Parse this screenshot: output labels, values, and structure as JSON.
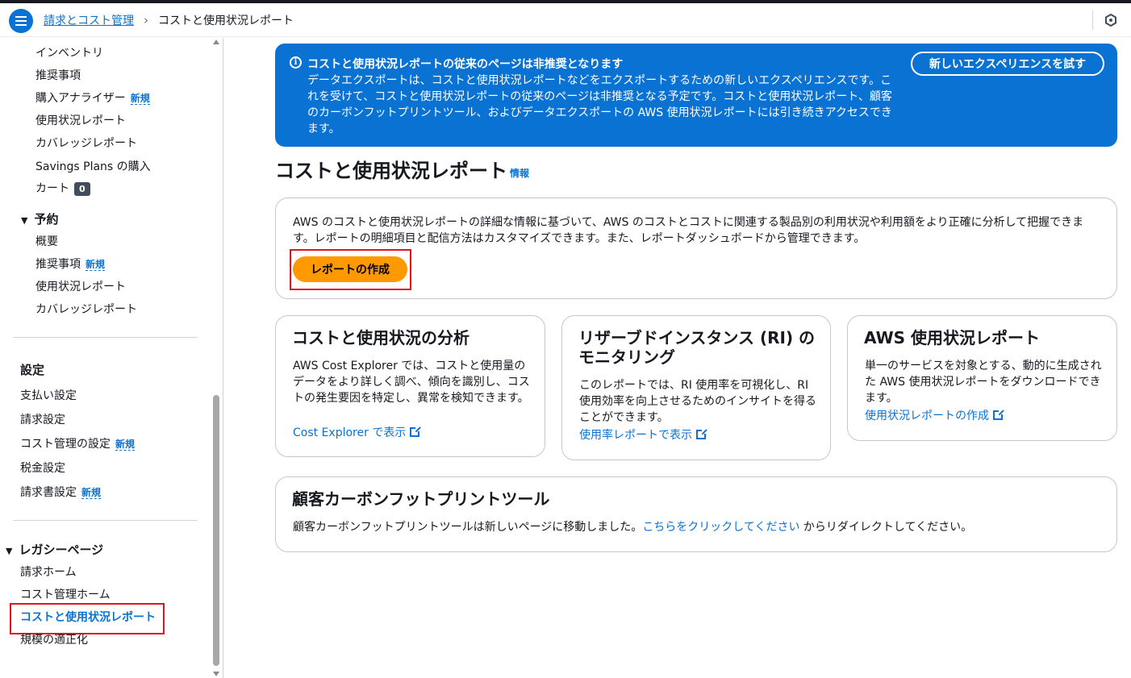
{
  "header": {
    "breadcrumb_parent": "請求とコスト管理",
    "breadcrumb_sep": "›",
    "breadcrumb_current": "コストと使用状況レポート"
  },
  "sidebar": {
    "items_top": [
      {
        "label": "インベントリ"
      },
      {
        "label": "推奨事項"
      },
      {
        "label": "購入アナライザー",
        "badge": "新規"
      },
      {
        "label": "使用状況レポート"
      },
      {
        "label": "カバレッジレポート"
      },
      {
        "label": "Savings Plans の購入"
      },
      {
        "label": "カート",
        "count": "0"
      }
    ],
    "reservations": {
      "title": "予約",
      "items": [
        {
          "label": "概要"
        },
        {
          "label": "推奨事項",
          "badge": "新規"
        },
        {
          "label": "使用状況レポート"
        },
        {
          "label": "カバレッジレポート"
        }
      ]
    },
    "settings": {
      "title": "設定",
      "items": [
        {
          "label": "支払い設定"
        },
        {
          "label": "請求設定"
        },
        {
          "label": "コスト管理の設定",
          "badge": "新規"
        },
        {
          "label": "税金設定"
        },
        {
          "label": "請求書設定",
          "badge": "新規"
        }
      ]
    },
    "legacy": {
      "title": "レガシーページ",
      "items": [
        {
          "label": "請求ホーム"
        },
        {
          "label": "コスト管理ホーム"
        },
        {
          "label": "コストと使用状況レポート",
          "active": true
        },
        {
          "label": "規模の適正化"
        }
      ]
    }
  },
  "banner": {
    "title": "コストと使用状況レポートの従来のページは非推奨となります",
    "body": "データエクスポートは、コストと使用状況レポートなどをエクスポートするための新しいエクスペリエンスです。これを受けて、コストと使用状況レポートの従来のページは非推奨となる予定です。コストと使用状況レポート、顧客のカーボンフットプリントツール、およびデータエクスポートの AWS 使用状況レポートには引き続きアクセスできます。",
    "button": "新しいエクスペリエンスを試す"
  },
  "page": {
    "title": "コストと使用状況レポート",
    "info": "情報"
  },
  "intro_card": {
    "text": "AWS のコストと使用状況レポートの詳細な情報に基づいて、AWS のコストとコストに関連する製品別の利用状況や利用額をより正確に分析して把握できます。レポートの明細項目と配信方法はカスタマイズできます。また、レポートダッシュボードから管理できます。",
    "button": "レポートの作成"
  },
  "cards": [
    {
      "title": "コストと使用状況の分析",
      "text": "AWS Cost Explorer では、コストと使用量のデータをより詳しく調べ、傾向を識別し、コストの発生要因を特定し、異常を検知できます。",
      "link": "Cost Explorer で表示"
    },
    {
      "title": "リザーブドインスタンス (RI) のモニタリング",
      "text": "このレポートでは、RI 使用率を可視化し、RI 使用効率を向上させるためのインサイトを得ることができます。",
      "link": "使用率レポートで表示"
    },
    {
      "title": "AWS 使用状況レポート",
      "text": "単一のサービスを対象とする、動的に生成された AWS 使用状況レポートをダウンロードできます。",
      "link": "使用状況レポートの作成"
    }
  ],
  "carbon_card": {
    "title": "顧客カーボンフットプリントツール",
    "text_before": "顧客カーボンフットプリントツールは新しいページに移動しました。",
    "link": "こちらをクリックしてください",
    "text_after": " からリダイレクトしてください。"
  },
  "colors": {
    "accent": "#0972d3",
    "primary_button": "#ff9900",
    "highlight": "#e0141e"
  }
}
